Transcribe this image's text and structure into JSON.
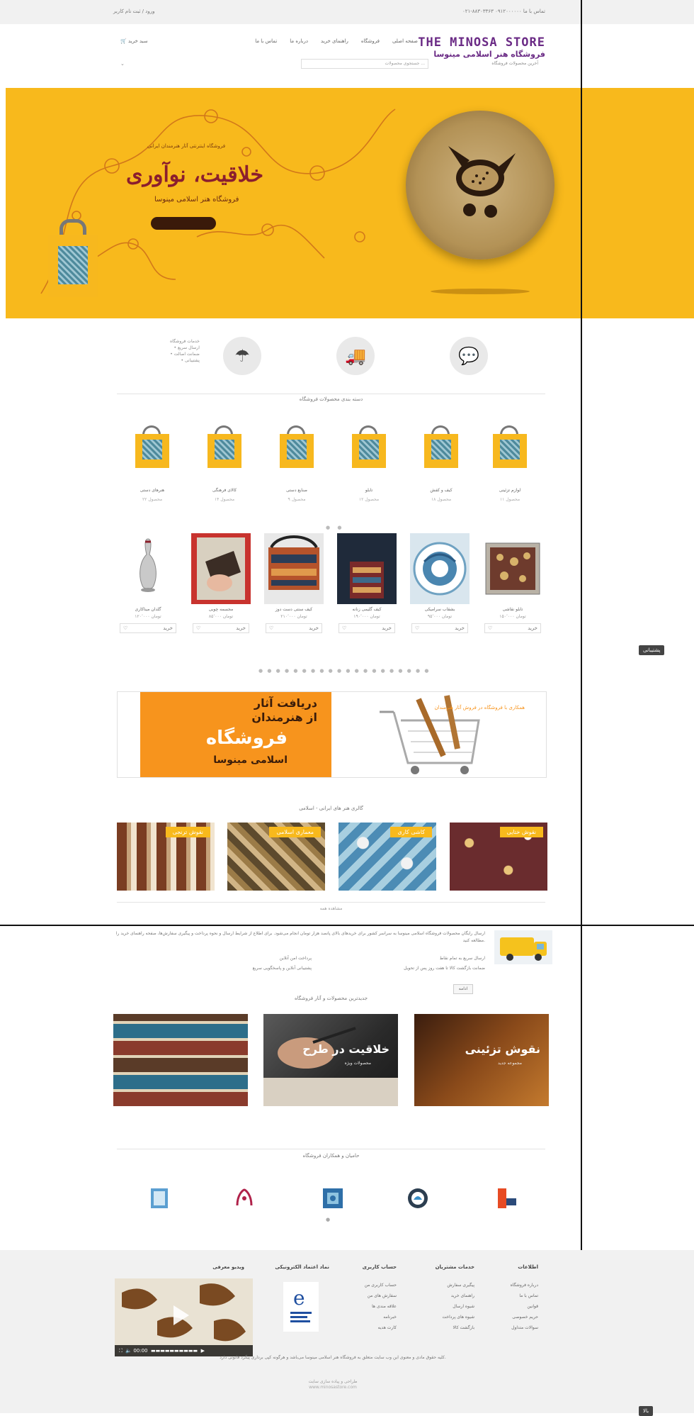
{
  "topbar": {
    "phone": "۰۲۱-۸۸۳۰۳۳۶۳ تماس با ما ۰۹۱۲۰۰۰۰۰۰",
    "login": "ورود / ثبت نام کاربر"
  },
  "header": {
    "logo_en": "THE MINOSA STORE",
    "logo_fa": "فروشگاه هنر اسلامی مینوسا",
    "nav": [
      "صفحه اصلی",
      "فروشگاه",
      "راهنمای خرید",
      "درباره ما",
      "تماس با ما"
    ],
    "cart": "سبد خرید",
    "search_placeholder": "جستجوی محصولات ...",
    "meta": "آخرین محصولات فروشگاه"
  },
  "hero": {
    "tagline": "فروشگاه اینترنتی آثار هنرمندان ایرانی",
    "title": "خلاقیت، نوآوری",
    "subtitle": "فروشگاه هنر اسلامی مینوسا"
  },
  "features": {
    "icons": [
      "umbrella-icon",
      "truck-icon",
      "chat-icon"
    ],
    "list": [
      "خدمات فروشگاه",
      "• ارسال سریع",
      "• ضمانت اصالت",
      "• پشتیبانی"
    ]
  },
  "categories_title": "دسته بندی محصولات فروشگاه",
  "categories": [
    {
      "name": "هنرهای دستی",
      "count": "۲۲ محصول"
    },
    {
      "name": "کالای فرهنگی",
      "count": "۱۴ محصول"
    },
    {
      "name": "صنایع دستی",
      "count": "۹ محصول"
    },
    {
      "name": "تابلو",
      "count": "۱۲ محصول"
    },
    {
      "name": "کیف و کفش",
      "count": "۱۸ محصول"
    },
    {
      "name": "لوازم تزئینی",
      "count": "۱۱ محصول"
    }
  ],
  "products": [
    {
      "name": "گلدان میناکاری",
      "price": "۱۲۰٬۰۰۰ تومان",
      "btn": "خرید"
    },
    {
      "name": "مجسمه چوبی",
      "price": "۸۵٬۰۰۰ تومان",
      "btn": "خرید"
    },
    {
      "name": "کیف سنتی دست دوز",
      "price": "۲۱۰٬۰۰۰ تومان",
      "btn": "خرید"
    },
    {
      "name": "کیف گلیمی زنانه",
      "price": "۱۹۰٬۰۰۰ تومان",
      "btn": "خرید"
    },
    {
      "name": "بشقاب سرامیکی",
      "price": "۹۵٬۰۰۰ تومان",
      "btn": "خرید"
    },
    {
      "name": "تابلو نقاشی",
      "price": "۱۵۰٬۰۰۰ تومان",
      "btn": "خرید"
    }
  ],
  "promo": {
    "line1": "دریافت آثار",
    "line2": "از هنرمندان",
    "line3": "فروشگاه",
    "line4": "اسلامی مینوسا",
    "side_text": "همکاری با فروشگاه در فروش آثار هنرمندان"
  },
  "gallery_title": "گالری هنر های ایرانی - اسلامی",
  "gallery": [
    "نقوش ختایی",
    "کاشی کاری",
    "معماری اسلامی",
    "نقوش ترنجی"
  ],
  "gallery_footer": "مشاهده همه",
  "info": {
    "paragraph": "ارسال رایگان محصولات فروشگاه اسلامی مینوسا به سراسر کشور برای خریدهای بالای پانصد هزار تومان انجام می‌شود. برای اطلاع از شرایط ارسال و نحوه پرداخت و پیگیری سفارش‌ها، صفحه راهنمای خرید را مطالعه کنید.",
    "row1_right": "ارسال سریع به تمام نقاط",
    "row1_left": "پرداخت امن آنلاین",
    "row2_right": "ضمانت بازگشت کالا تا هفت روز پس از تحویل",
    "row2_left": "پشتیبانی آنلاین و پاسخگویی سریع",
    "button": "ادامه"
  },
  "banners_title": "جدیدترین محصولات و آثار فروشگاه",
  "banners": [
    {
      "big": "نقوش تزئینی",
      "small": "مجموعه جدید"
    },
    {
      "big": "خلاقیت در طرح",
      "small": "محصولات ویژه"
    },
    {
      "big": "",
      "small": ""
    }
  ],
  "partners_title": "حامیان و همکاران فروشگاه",
  "footer": {
    "cols": [
      {
        "head": "اطلاعات",
        "items": [
          "درباره فروشگاه",
          "تماس با ما",
          "قوانین",
          "حریم خصوصی",
          "سوالات متداول"
        ]
      },
      {
        "head": "خدمات مشتریان",
        "items": [
          "پیگیری سفارش",
          "راهنمای خرید",
          "شیوه ارسال",
          "شیوه های پرداخت",
          "بازگشت کالا"
        ]
      },
      {
        "head": "حساب کاربری",
        "items": [
          "حساب کاربری من",
          "سفارش های من",
          "علاقه مندی ها",
          "خبرنامه",
          "کارت هدیه"
        ]
      },
      {
        "head": "نماد اعتماد الکترونیکی",
        "items": []
      },
      {
        "head": "ویدیو معرفی",
        "items": []
      }
    ],
    "video_time": "00:00",
    "copyright": "کلیه حقوق مادی و معنوی این وب سایت متعلق به فروشگاه هنر اسلامی مینوسا می‌باشد و هرگونه کپی برداری پیگرد قانونی دارد.",
    "line2": "طراحی و پیاده سازی سایت",
    "line3": "www.minosastore.com"
  },
  "side": {
    "tag1": "پشتیبانی",
    "tag2": "بالا"
  }
}
